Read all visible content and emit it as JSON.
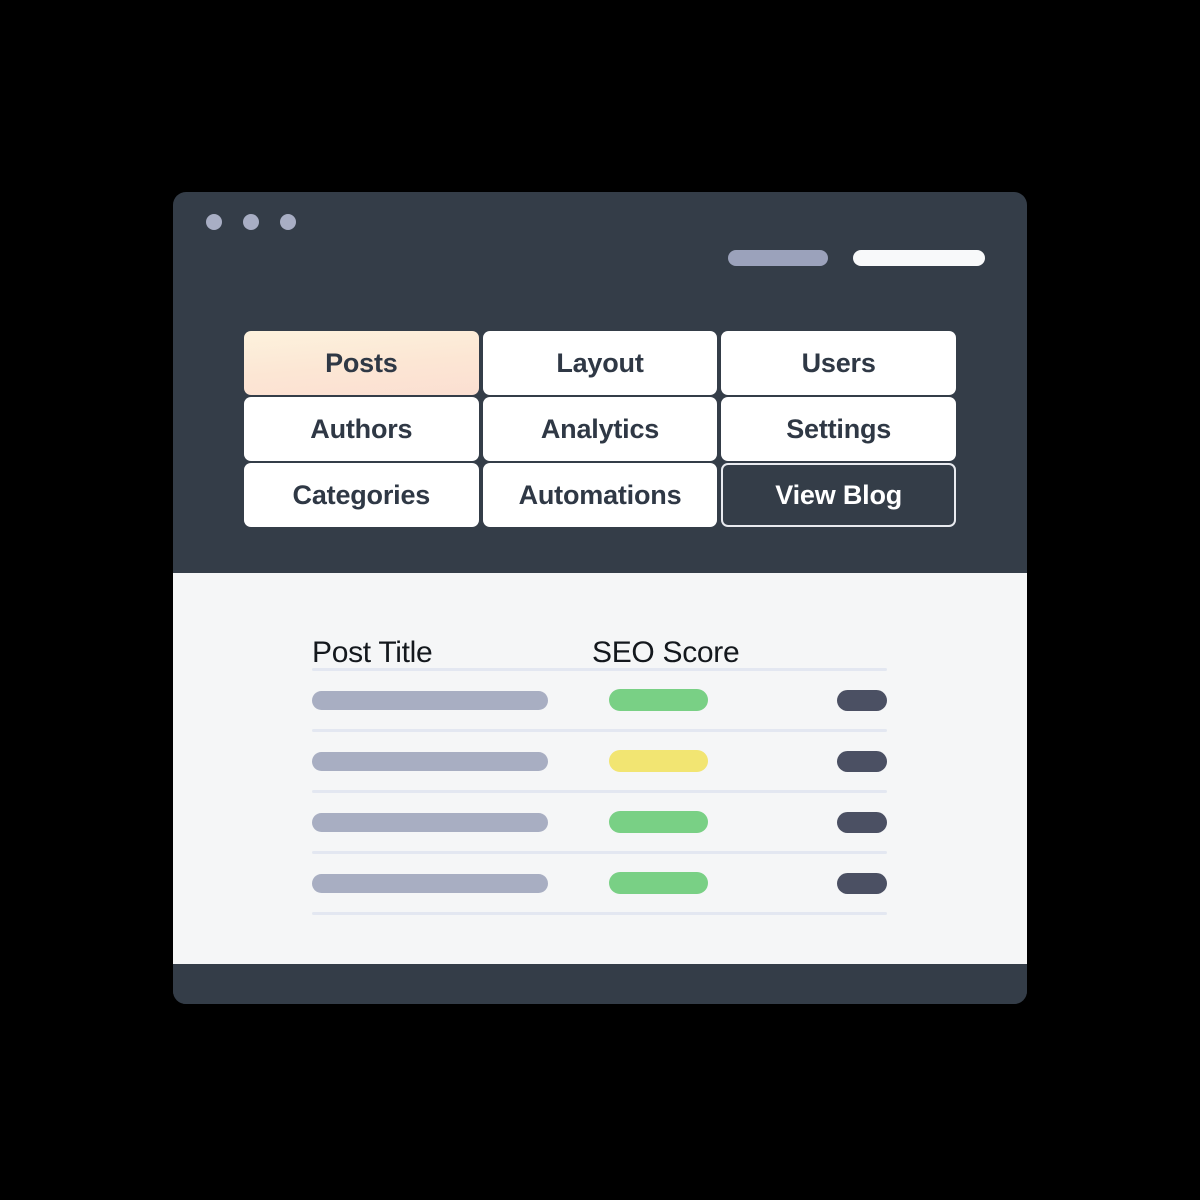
{
  "window": {
    "title_bar": {
      "dots": [
        "window-dot-red",
        "window-dot-yellow",
        "window-dot-green"
      ]
    },
    "top_bar_pills": [
      {
        "name": "account-pill",
        "color": "#9ba2bb"
      },
      {
        "name": "search-pill",
        "color": "#f8f9fa"
      }
    ]
  },
  "nav": {
    "items": [
      {
        "label": "Posts",
        "state": "active"
      },
      {
        "label": "Layout",
        "state": "default"
      },
      {
        "label": "Users",
        "state": "default"
      },
      {
        "label": "Authors",
        "state": "default"
      },
      {
        "label": "Analytics",
        "state": "default"
      },
      {
        "label": "Settings",
        "state": "default"
      },
      {
        "label": "Categories",
        "state": "default"
      },
      {
        "label": "Automations",
        "state": "default"
      },
      {
        "label": "View Blog",
        "state": "ghost"
      }
    ]
  },
  "table": {
    "columns": [
      "Post Title",
      "SEO Score"
    ],
    "rows": [
      {
        "title_placeholder": "post-title-bar",
        "seo_score": "good",
        "action": "row-action-button"
      },
      {
        "title_placeholder": "post-title-bar",
        "seo_score": "warn",
        "action": "row-action-button"
      },
      {
        "title_placeholder": "post-title-bar",
        "seo_score": "good",
        "action": "row-action-button"
      },
      {
        "title_placeholder": "post-title-bar",
        "seo_score": "good",
        "action": "row-action-button"
      }
    ]
  },
  "colors": {
    "window_chrome": "#343d48",
    "content_bg": "#f5f6f7",
    "active_tab_start": "#fdf2dd",
    "active_tab_end": "#fbdfd2",
    "score_good": "#79d085",
    "score_warn": "#f2e572",
    "action_pill": "#4b5063",
    "title_pill": "#a8aec2",
    "divider": "#e3e7f1",
    "dot": "#a8aec4"
  }
}
